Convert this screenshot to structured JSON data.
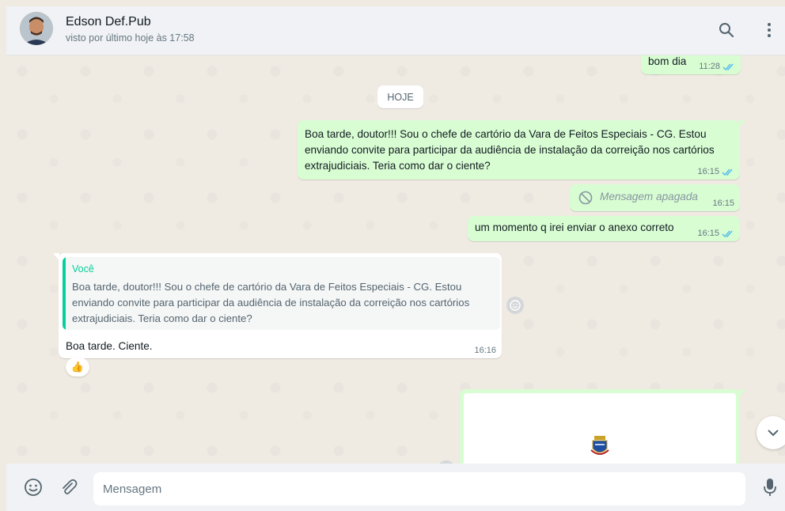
{
  "header": {
    "contact_name": "Edson Def.Pub",
    "status": "visto por último hoje às 17:58",
    "search_icon": "search-icon",
    "menu_icon": "kebab-menu-icon"
  },
  "chat": {
    "day_separator": "HOJE",
    "messages": [
      {
        "direction": "out",
        "text": "bom dia",
        "time": "11:28",
        "status": "read"
      },
      {
        "direction": "out",
        "text": "Boa tarde, doutor!!! Sou o chefe de cartório da Vara de Feitos Especiais - CG. Estou enviando convite para participar da audiência de instalação da correição nos cartórios extrajudiciais. Teria como dar o ciente?",
        "time": "16:15",
        "status": "read"
      },
      {
        "direction": "out",
        "text": "Mensagem apagada",
        "time": "16:15",
        "deleted": true
      },
      {
        "direction": "out",
        "text": "um momento q irei enviar o anexo correto",
        "time": "16:15",
        "status": "read"
      },
      {
        "direction": "in",
        "quote_author": "Você",
        "quote_text": "Boa tarde, doutor!!! Sou o chefe de cartório da Vara de Feitos Especiais - CG. Estou enviando convite para participar da audiência de instalação da correição nos cartórios extrajudiciais. Teria como dar o ciente?",
        "text": "Boa tarde.  Ciente.",
        "time": "16:16",
        "reaction": "👍"
      },
      {
        "direction": "out",
        "type": "document-preview",
        "icon": "coat-of-arms-icon"
      }
    ]
  },
  "composer": {
    "placeholder": "Mensagem",
    "emoji_icon": "emoji-icon",
    "attach_icon": "paperclip-icon",
    "mic_icon": "microphone-icon"
  },
  "colors": {
    "outgoing_bubble": "#d9fdd3",
    "incoming_bubble": "#ffffff",
    "read_ticks": "#53bdeb",
    "quote_accent": "#06cf9c",
    "chat_background": "#efeae2"
  }
}
